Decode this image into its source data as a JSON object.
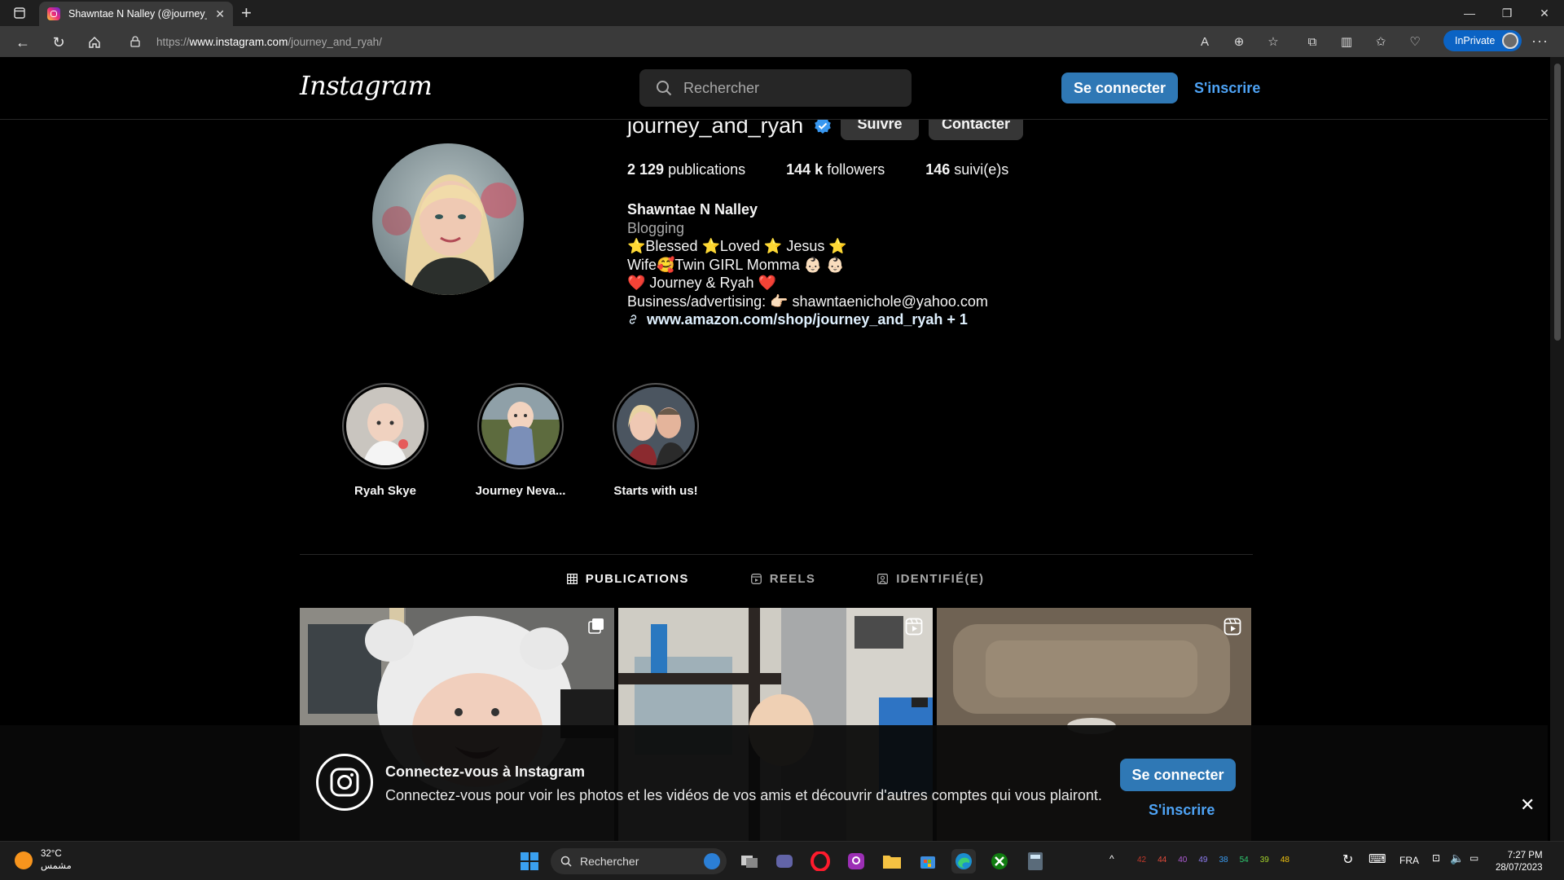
{
  "browser": {
    "tab_title": "Shawntae N Nalley (@journey_ar",
    "url_prefix": "https://",
    "url_domain": "www.instagram.com",
    "url_path": "/journey_and_ryah/",
    "inprivate_label": "InPrivate"
  },
  "nav": {
    "logo": "Instagram",
    "search_placeholder": "Rechercher",
    "login_label": "Se connecter",
    "signup_label": "S'inscrire"
  },
  "profile": {
    "username": "journey_and_ryah",
    "follow_label": "Suivre",
    "contact_label": "Contacter",
    "stats": {
      "posts_count": "2 129",
      "posts_label": "publications",
      "followers_count": "144 k",
      "followers_label": "followers",
      "following_count": "146",
      "following_label": "suivi(e)s"
    },
    "name": "Shawntae N Nalley",
    "category": "Blogging",
    "bio_lines": [
      "⭐Blessed ⭐Loved ⭐ Jesus ⭐",
      "Wife🥰Twin GIRL Momma 👶🏻 👶🏻",
      "❤️ Journey & Ryah ❤️",
      "Business/advertising: 👉🏻 shawntaenichole@yahoo.com"
    ],
    "link": "www.amazon.com/shop/journey_and_ryah + 1"
  },
  "highlights": [
    {
      "label": "Ryah Skye"
    },
    {
      "label": "Journey Neva..."
    },
    {
      "label": "Starts with us!"
    }
  ],
  "tabs": [
    {
      "label": "PUBLICATIONS",
      "icon": "grid-icon",
      "active": true
    },
    {
      "label": "REELS",
      "icon": "reels-icon",
      "active": false
    },
    {
      "label": "IDENTIFIÉ(E)",
      "icon": "tagged-icon",
      "active": false
    }
  ],
  "grid_badges": [
    "carousel-icon",
    "reels-icon",
    "reels-icon"
  ],
  "login_banner": {
    "title": "Connectez-vous à Instagram",
    "text": "Connectez-vous pour voir les photos et les vidéos de vos amis et découvrir d'autres comptes qui vous plairont.",
    "login_label": "Se connecter",
    "signup_label": "S'inscrire"
  },
  "taskbar": {
    "temperature": "32°C",
    "weather_text": "مشمس",
    "search_label": "Rechercher",
    "tray_numbers": [
      "42",
      "44",
      "40",
      "49",
      "38",
      "54",
      "39",
      "48"
    ],
    "language": "FRA",
    "time": "7:27 PM",
    "date": "28/07/2023"
  },
  "colors": {
    "accent_blue": "#2f78b5",
    "link_blue": "#4ea3f5",
    "tray_colors": [
      "#c0392b",
      "#e74c3c",
      "#b05cd6",
      "#8e7cf0",
      "#3a9bf0",
      "#2ecc71",
      "#a3d12b",
      "#f1c40f"
    ]
  }
}
